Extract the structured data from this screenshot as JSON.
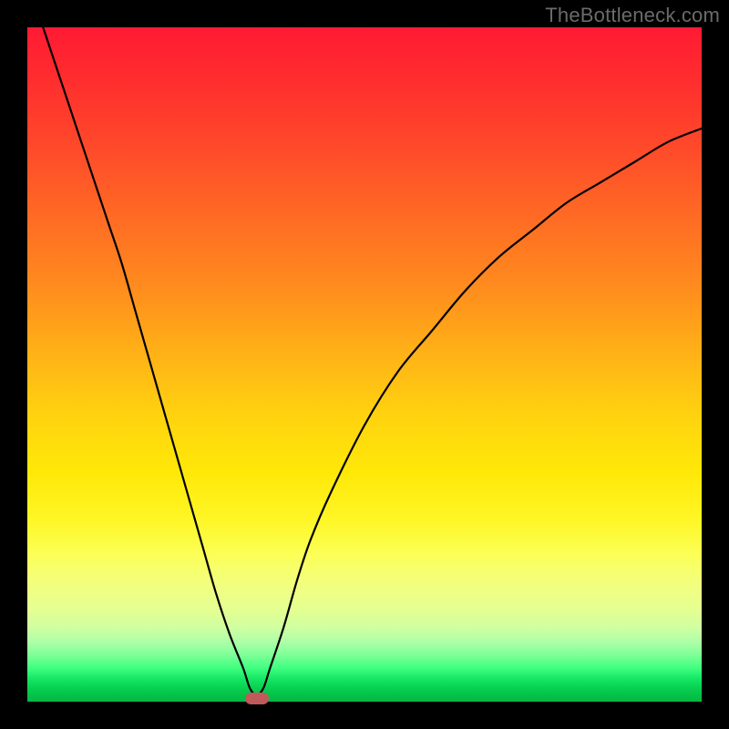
{
  "watermark": "TheBottleneck.com",
  "colors": {
    "frame": "#000000",
    "curve": "#000000",
    "marker": "#c05a5a",
    "gradient_top": "#ff1a33",
    "gradient_mid": "#ffe808",
    "gradient_bottom": "#02b843"
  },
  "chart_data": {
    "type": "line",
    "title": "",
    "xlabel": "",
    "ylabel": "",
    "xlim": [
      0,
      100
    ],
    "ylim": [
      0,
      100
    ],
    "grid": false,
    "legend": false,
    "series": [
      {
        "name": "bottleneck-curve",
        "x": [
          0,
          2,
          4,
          6,
          8,
          10,
          12,
          14,
          16,
          18,
          20,
          22,
          24,
          26,
          28,
          30,
          32,
          33,
          34,
          35,
          36,
          38,
          40,
          42,
          45,
          50,
          55,
          60,
          65,
          70,
          75,
          80,
          85,
          90,
          95,
          100
        ],
        "values": [
          107,
          101,
          95,
          89,
          83,
          77,
          71,
          65,
          58,
          51,
          44,
          37,
          30,
          23,
          16,
          10,
          5,
          2,
          1,
          2,
          5,
          11,
          18,
          24,
          31,
          41,
          49,
          55,
          61,
          66,
          70,
          74,
          77,
          80,
          83,
          85
        ]
      }
    ],
    "annotations": [
      {
        "name": "min-marker",
        "x": 34,
        "y": 0,
        "shape": "rounded-rect",
        "color": "#c05a5a"
      }
    ]
  }
}
